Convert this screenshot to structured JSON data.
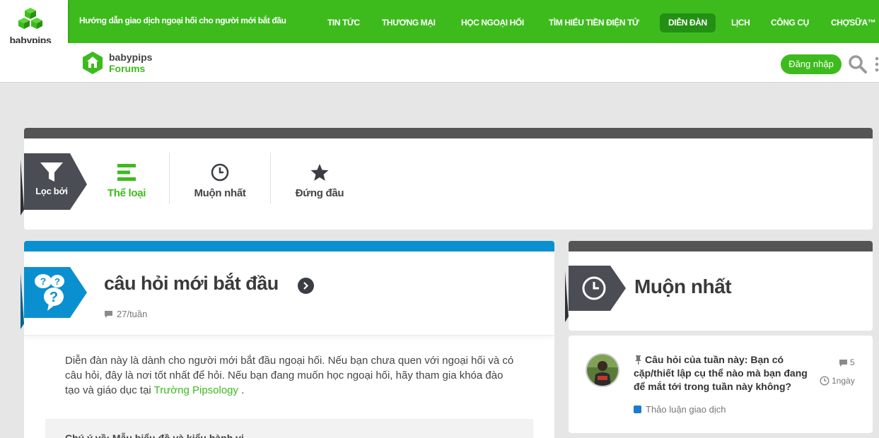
{
  "topbar": {
    "logo_text": "babypips",
    "tagline": "Hướng dẫn giao dịch ngoại hối cho người mới bắt đầu",
    "nav": [
      "Tin tức",
      "thương mại",
      "Học ngoại hối",
      "Tìm hiểu tiền điện tử",
      "Diễn đàn",
      "Lịch",
      "Công cụ",
      "ChợSữa™"
    ],
    "active_nav": "Diễn đàn"
  },
  "subheader": {
    "forum_name": "babypips",
    "forum_sub": "Forums",
    "login_label": "Đăng nhập",
    "search_icon": "search-icon",
    "more_icon": "more-vertical-icon"
  },
  "filter": {
    "tag_label": "Lọc bởi",
    "buttons": [
      {
        "label": "Thể loại",
        "icon": "categories-icon",
        "active": true
      },
      {
        "label": "Muộn nhất",
        "icon": "clock-icon",
        "active": false
      },
      {
        "label": "Đứng đầu",
        "icon": "star-icon",
        "active": false
      }
    ]
  },
  "category": {
    "title": "câu hỏi mới bắt đầu",
    "rate": "27/tuần",
    "desc_text": "Diễn đàn này là dành cho người mới bắt đầu ngoại hối. Nếu bạn chưa quen với ngoại hối và có câu hỏi, đây là nơi tốt nhất để hỏi. Nếu bạn đang muốn học ngoại hối, hãy tham gia khóa đào tạo và giáo dục tại ",
    "desc_link": "Trường Pipsology",
    "desc_end": " .",
    "subbox_text": "Chú ý về: Mẫu biểu đồ và kiểu hành vi",
    "accent_color": "#0a90d0"
  },
  "latest": {
    "title": "Muộn nhất",
    "topic": {
      "title": "Câu hỏi của tuần này: Bạn có cặp/thiết lập cụ thể nào mà bạn đang để mắt tới trong tuần này không?",
      "replies": "5",
      "age": "1ngày",
      "category": "Thảo luận giao dịch",
      "category_color": "#1a7bd1"
    }
  },
  "colors": {
    "brand_green": "#3dbb1d",
    "active_nav_bg": "#238f14",
    "dark_strip": "#555555"
  }
}
